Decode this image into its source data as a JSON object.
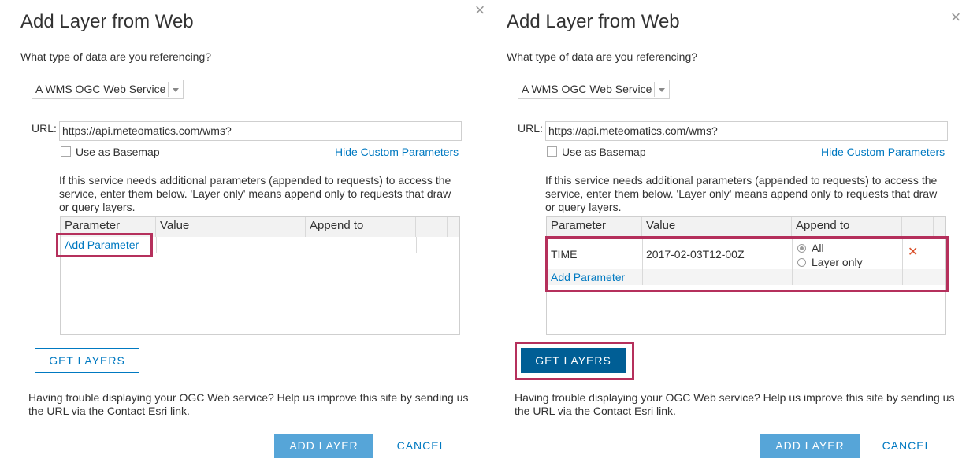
{
  "dialogs": [
    {
      "title": "Add Layer from Web",
      "close_glyph": "×",
      "question": "What type of data are you referencing?",
      "data_type": "A WMS OGC Web Service",
      "url_label": "URL:",
      "url_value": "https://api.meteomatics.com/wms?",
      "basemap_label": "Use as Basemap",
      "hide_params_link": "Hide Custom Parameters",
      "info_text": "If this service needs additional parameters (appended to requests) to access the service, enter them below. 'Layer only' means append only to requests that draw or query layers.",
      "columns": [
        "Parameter",
        "Value",
        "Append to"
      ],
      "add_parameter": "Add Parameter",
      "get_layers": "GET LAYERS",
      "help_text": "Having trouble displaying your OGC Web service? Help us improve this site by sending us the URL via the Contact Esri link.",
      "add_layer": "ADD LAYER",
      "cancel": "CANCEL"
    },
    {
      "title": "Add Layer from Web",
      "close_glyph": "×",
      "question": "What type of data are you referencing?",
      "data_type": "A WMS OGC Web Service",
      "url_label": "URL:",
      "url_value": "https://api.meteomatics.com/wms?",
      "basemap_label": "Use as Basemap",
      "hide_params_link": "Hide Custom Parameters",
      "info_text": "If this service needs additional parameters (appended to requests) to access the service, enter them below. 'Layer only' means append only to requests that draw or query layers.",
      "columns": [
        "Parameter",
        "Value",
        "Append to"
      ],
      "row": {
        "parameter": "TIME",
        "value": "2017-02-03T12-00Z",
        "append_options": [
          "All",
          "Layer only"
        ],
        "append_selected": "All",
        "remove_glyph": "✕"
      },
      "add_parameter": "Add Parameter",
      "get_layers": "GET LAYERS",
      "help_text": "Having trouble displaying your OGC Web service? Help us improve this site by sending us the URL via the Contact Esri link.",
      "add_layer": "ADD LAYER",
      "cancel": "CANCEL"
    }
  ],
  "colors": {
    "accent": "#0079c1",
    "highlight": "#b5305c",
    "primary_button": "#56a5d8",
    "get_layers_active": "#005e95",
    "remove": "#d9512c"
  }
}
